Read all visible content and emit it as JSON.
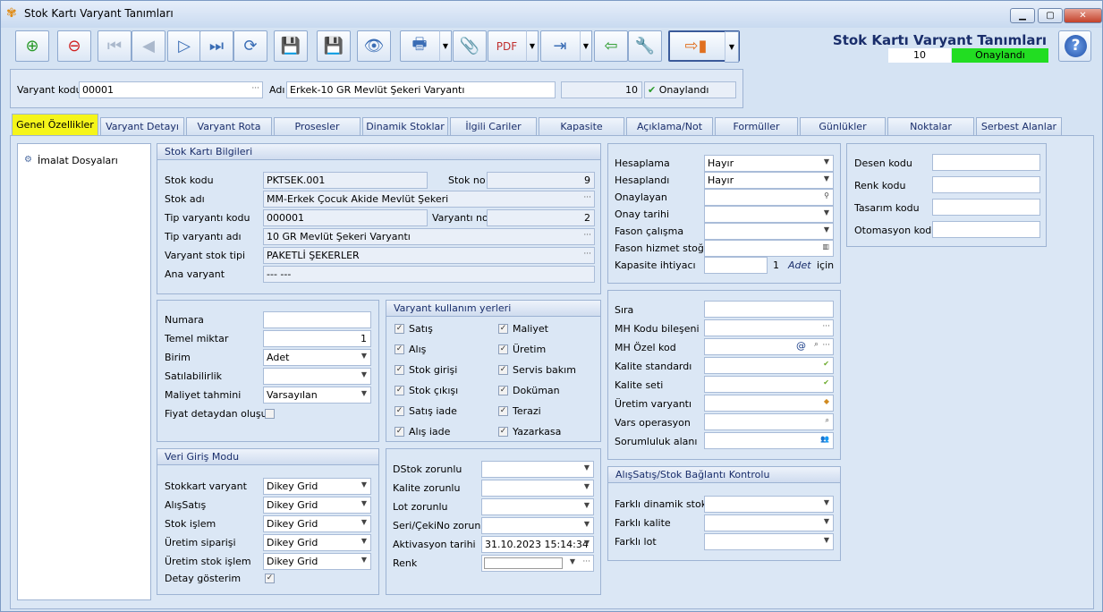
{
  "window": {
    "title": "Stok Kartı Varyant Tanımları"
  },
  "header": {
    "app_title": "Stok Kartı Varyant Tanımları",
    "status_number": "10",
    "status_text": "Onaylandı",
    "help": "?"
  },
  "topbar": {
    "varyant_kodu_label": "Varyant kodu",
    "varyant_kodu": "00001",
    "adi_label": "Adı",
    "adi": "Erkek-10 GR Mevlüt Şekeri Varyantı",
    "number": "10",
    "onay": "Onaylandı"
  },
  "tabs": [
    "Genel Özellikler",
    "Varyant Detayı",
    "Varyant Rota",
    "Prosesler",
    "Dinamik Stoklar",
    "İlgili Cariler",
    "Kapasite",
    "Açıklama/Not",
    "Formüller",
    "Günlükler",
    "Noktalar",
    "Serbest Alanlar"
  ],
  "tree": {
    "item": "İmalat Dosyaları"
  },
  "stok": {
    "title": "Stok Kartı Bilgileri",
    "stok_kodu_l": "Stok kodu",
    "stok_kodu": "PKTSEK.001",
    "stok_no_l": "Stok no",
    "stok_no": "9",
    "stok_adi_l": "Stok adı",
    "stok_adi": "MM-Erkek Çocuk Akide Mevlüt Şekeri",
    "tip_kodu_l": "Tip varyantı kodu",
    "tip_kodu": "000001",
    "varyant_no_l": "Varyantı no",
    "varyant_no": "2",
    "tip_adi_l": "Tip varyantı adı",
    "tip_adi": "10 GR Mevlüt Şekeri Varyantı",
    "stok_tipi_l": "Varyant stok tipi",
    "stok_tipi": "PAKETLİ ŞEKERLER",
    "ana_l": "Ana varyant",
    "ana": "--- ---"
  },
  "numara": {
    "numara_l": "Numara",
    "numara": "",
    "temel_l": "Temel miktar",
    "temel": "1",
    "birim_l": "Birim",
    "birim": "Adet",
    "satil_l": "Satılabilirlik",
    "satil": "",
    "maliyet_l": "Maliyet tahmini",
    "maliyet": "Varsayılan",
    "fiyat_l": "Fiyat detaydan oluşur"
  },
  "kullanim": {
    "title": "Varyant kullanım yerleri",
    "left": [
      "Satış",
      "Alış",
      "Stok girişi",
      "Stok çıkışı",
      "Satış iade",
      "Alış iade"
    ],
    "right": [
      "Maliyet",
      "Üretim",
      "Servis bakım",
      "Doküman",
      "Terazi",
      "Yazarkasa"
    ]
  },
  "veri": {
    "title": "Veri Giriş Modu",
    "rows": [
      {
        "l": "Stokkart varyant",
        "v": "Dikey Grid"
      },
      {
        "l": "AlışSatış",
        "v": "Dikey Grid"
      },
      {
        "l": "Stok işlem",
        "v": "Dikey Grid"
      },
      {
        "l": "Üretim siparişi",
        "v": "Dikey Grid"
      },
      {
        "l": "Üretim stok işlem",
        "v": "Dikey Grid"
      }
    ],
    "detay_l": "Detay gösterim"
  },
  "zorunlu": {
    "dstok_l": "DStok zorunlu",
    "kalite_l": "Kalite zorunlu",
    "lot_l": "Lot zorunlu",
    "seri_l": "Seri/ÇekiNo zorunlu",
    "akt_l": "Aktivasyon tarihi",
    "akt": "31.10.2023 15:14:34",
    "renk_l": "Renk"
  },
  "hesap": {
    "hesaplama_l": "Hesaplama",
    "hesaplama": "Hayır",
    "hesaplandi_l": "Hesaplandı",
    "hesaplandi": "Hayır",
    "onaylayan_l": "Onaylayan",
    "onay_tarihi_l": "Onay tarihi",
    "fason_l": "Fason çalışma",
    "fason_hiz_l": "Fason hizmet stoğu",
    "kapasite_l": "Kapasite ihtiyacı",
    "kap_n": "1",
    "kap_u": "Adet",
    "kap_s": "için"
  },
  "sira": {
    "rows": [
      "Sıra",
      "MH Kodu bileşeni",
      "MH Özel kod",
      "Kalite standardı",
      "Kalite seti",
      "Üretim varyantı",
      "Vars operasyon",
      "Sorumluluk alanı"
    ]
  },
  "alis": {
    "title": "AlışSatış/Stok Bağlantı Kontrolu",
    "rows": [
      "Farklı dinamik stok",
      "Farklı kalite",
      "Farklı lot"
    ]
  },
  "desen": {
    "rows": [
      "Desen kodu",
      "Renk kodu",
      "Tasarım kodu",
      "Otomasyon kodu"
    ]
  }
}
